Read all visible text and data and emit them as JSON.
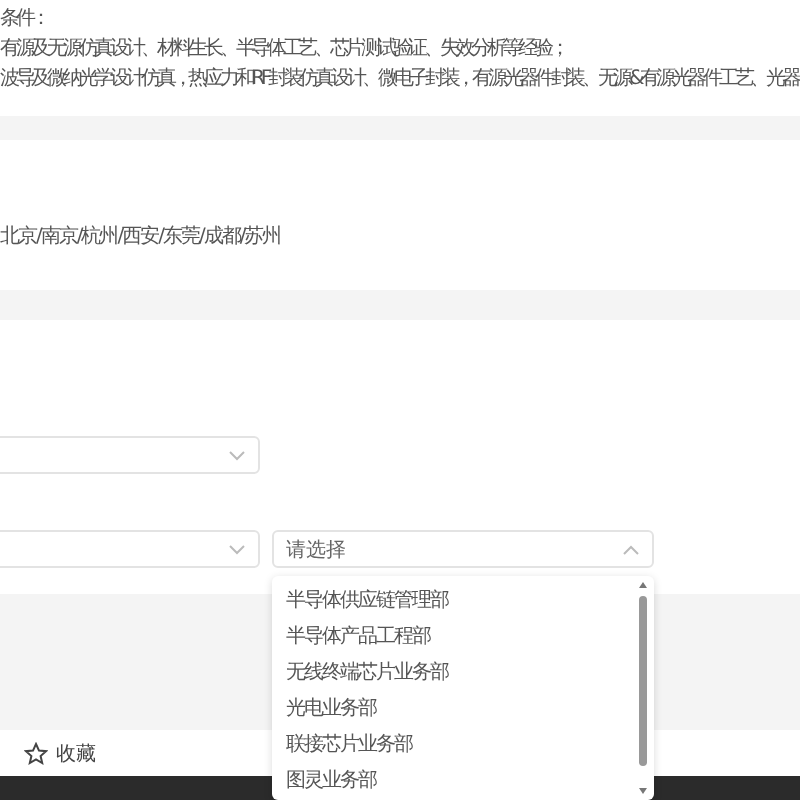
{
  "requirements": {
    "heading": "条件：",
    "lines": [
      "有源及无源仿真设计、材料生长、半导体工艺、芯片测试验证、失效分析等经验；",
      "波导及微纳光学设计仿真，热应力和RF封装仿真设计、微电子封装，有源光器件封装、无源&有源光器件工艺、光器"
    ]
  },
  "locations": {
    "text": "北京/南京/杭州/西安/东莞/成都/苏州"
  },
  "form": {
    "select_1": {
      "expanded": false
    },
    "select_2": {
      "expanded": false
    },
    "select_3": {
      "placeholder": "请选择",
      "expanded": true,
      "options": [
        "半导体供应链管理部",
        "半导体产品工程部",
        "无线终端芯片业务部",
        "光电业务部",
        "联接芯片业务部",
        "图灵业务部"
      ]
    }
  },
  "footer": {
    "favorite": "收藏"
  }
}
